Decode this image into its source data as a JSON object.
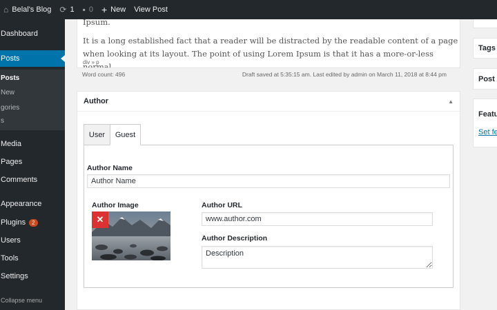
{
  "admin_bar": {
    "site_name": "Belal's Blog",
    "updates_count": "1",
    "comments_count": "0",
    "new_label": "New",
    "view_post_label": "View Post"
  },
  "sidebar": {
    "items": [
      {
        "label": "Dashboard"
      },
      {
        "label": "Posts"
      },
      {
        "label": "Media"
      },
      {
        "label": "Pages"
      },
      {
        "label": "Comments"
      },
      {
        "label": "Appearance"
      },
      {
        "label": "Plugins"
      },
      {
        "label": "Users"
      },
      {
        "label": "Tools"
      },
      {
        "label": "Settings"
      }
    ],
    "submenu": [
      {
        "label": "Posts"
      },
      {
        "label": "New"
      },
      {
        "label": "gories"
      },
      {
        "label": "s"
      }
    ],
    "plugins_badge": "2",
    "collapse_label": "Collapse menu"
  },
  "right_panels": {
    "tags": "Tags",
    "post_attr": "Post A",
    "featured": "Featu",
    "set_featured": "Set fe"
  },
  "editor": {
    "line_top": "Ipsum.",
    "paragraph": "It is a long established fact that a reader will be distracted by the readable content of a page when looking at its layout. The point of using Lorem Ipsum is that it has a more-or-less normal",
    "path": "div » p",
    "word_count": "Word count: 496",
    "draft_status": "Draft saved at 5:35:15 am. Last edited by admin on March 11, 2018 at 8:44 pm"
  },
  "author_box": {
    "title": "Author",
    "tabs": [
      {
        "label": "User"
      },
      {
        "label": "Guest"
      }
    ],
    "author_name_label": "Author Name",
    "author_name_value": "Author Name",
    "author_image_label": "Author Image",
    "remove_symbol": "✕",
    "author_url_label": "Author URL",
    "author_url_value": "www.author.com",
    "author_description_label": "Author Description",
    "author_description_value": "Description"
  },
  "colors": {
    "accent": "#0073aa",
    "admin_dark": "#23282d",
    "remove_red": "#dc3232",
    "badge": "#ca4a1f"
  }
}
